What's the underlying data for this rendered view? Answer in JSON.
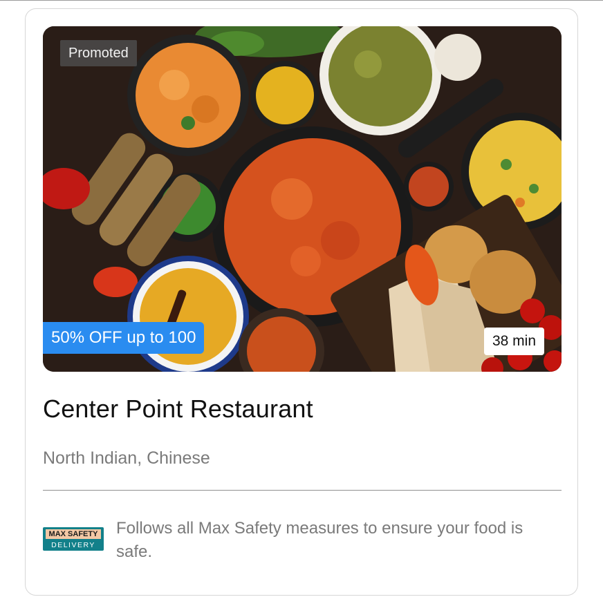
{
  "card": {
    "badge": "Promoted",
    "offer": "50% OFF up to 100",
    "delivery_time": "38 min",
    "restaurant_name": "Center Point Restaurant",
    "cuisines": "North Indian, Chinese",
    "safety": {
      "logo_line1": "MAX SAFETY",
      "logo_line2": "DELIVERY",
      "text": "Follows all Max Safety measures to ensure your food is safe."
    }
  },
  "colors": {
    "offer_blue": "#2a8cf0",
    "safety_teal": "#12808a",
    "muted_text": "#7a7a7a"
  }
}
